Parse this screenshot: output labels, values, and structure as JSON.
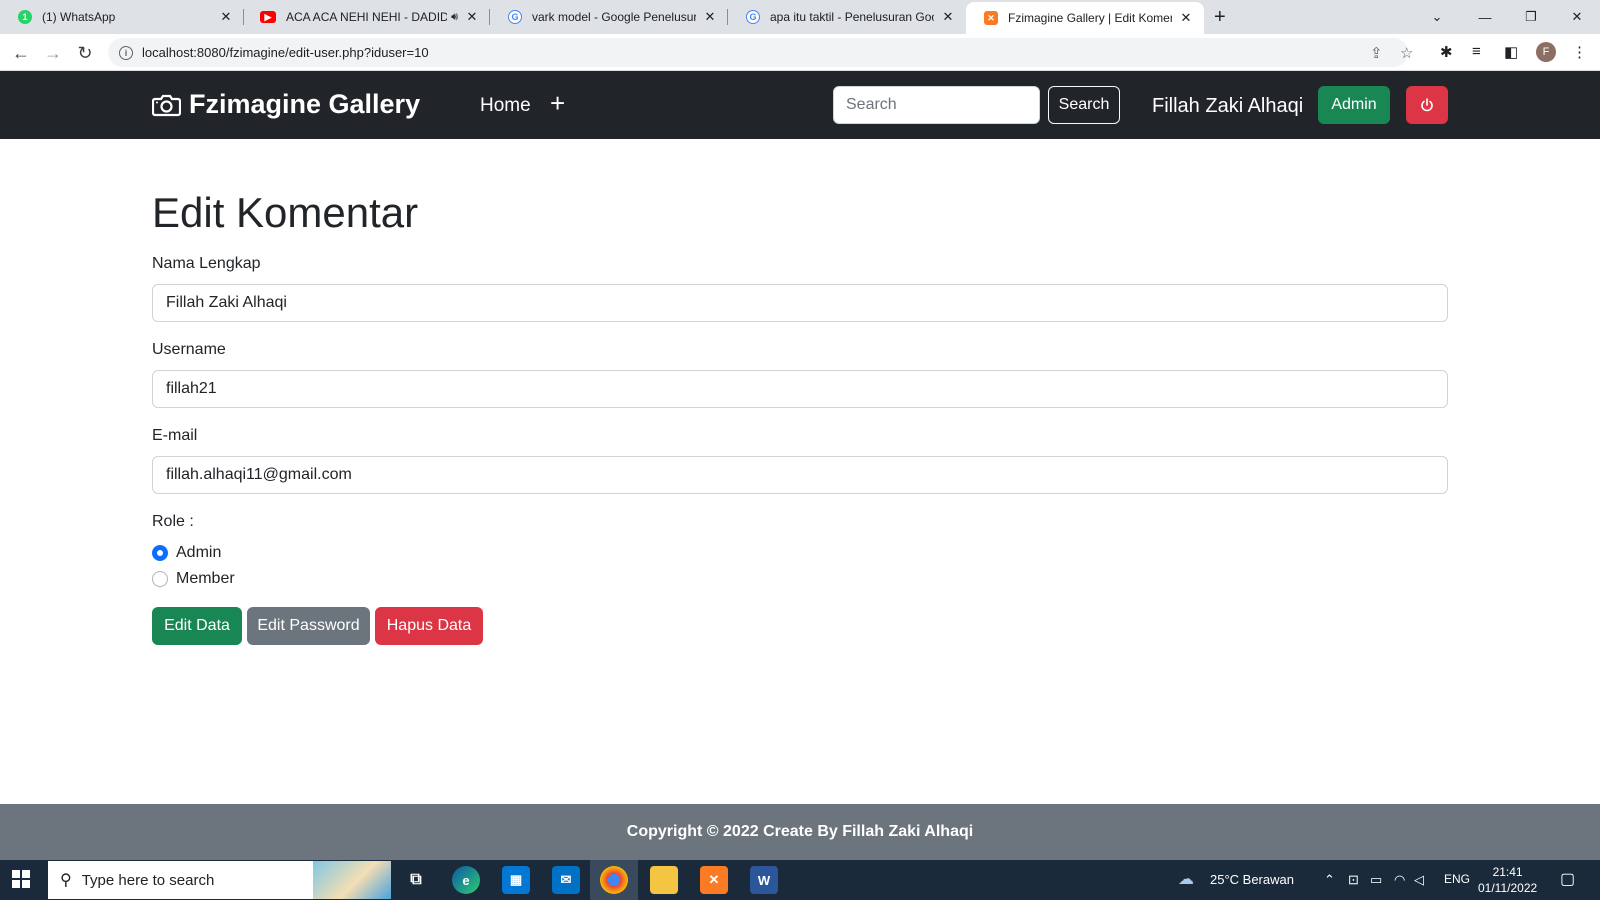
{
  "browser": {
    "tabs": [
      {
        "title": "(1) WhatsApp",
        "icon": "whatsapp-icon",
        "color": "#25d366"
      },
      {
        "title": "ACA ACA NEHI NEHI - DADIDADIDA",
        "icon": "youtube-icon",
        "color": "#ff0000"
      },
      {
        "title": "vark model - Google Penelusuran",
        "icon": "google-icon",
        "color": "#4285f4"
      },
      {
        "title": "apa itu taktil - Penelusuran Google",
        "icon": "google-icon",
        "color": "#4285f4"
      },
      {
        "title": "Fzimagine Gallery | Edit Komentar",
        "icon": "xampp-icon",
        "color": "#fb7a24"
      }
    ],
    "url": "localhost:8080/fzimagine/edit-user.php?iduser=10",
    "profile_initial": "F"
  },
  "navbar": {
    "brand": "Fzimagine Gallery",
    "home": "Home",
    "add": "+",
    "search_placeholder": "Search",
    "search_button": "Search",
    "user_name": "Fillah Zaki Alhaqi",
    "role_button": "Admin",
    "colors": {
      "bg": "#212529",
      "admin": "#198754",
      "logout": "#dc3545"
    }
  },
  "form": {
    "title": "Edit Komentar",
    "fullname_label": "Nama Lengkap",
    "fullname_value": "Fillah Zaki Alhaqi",
    "username_label": "Username",
    "username_value": "fillah21",
    "email_label": "E-mail",
    "email_value": "fillah.alhaqi11@gmail.com",
    "role_label": "Role :",
    "role_options": [
      {
        "label": "Admin",
        "checked": true
      },
      {
        "label": "Member",
        "checked": false
      }
    ],
    "buttons": {
      "edit_data": "Edit Data",
      "edit_password": "Edit Password",
      "delete_data": "Hapus Data"
    },
    "button_colors": {
      "edit_data": "#198754",
      "edit_password": "#6c757d",
      "delete_data": "#dc3545"
    }
  },
  "footer": {
    "text": "Copyright © 2022 Create By Fillah Zaki Alhaqi"
  },
  "taskbar": {
    "search_placeholder": "Type here to search",
    "weather": "25°C  Berawan",
    "language": "ENG",
    "time": "21:41",
    "date": "01/11/2022",
    "apps": [
      "task-view-icon",
      "edge-icon",
      "store-icon",
      "mail-icon",
      "chrome-icon",
      "file-explorer-icon",
      "xampp-icon",
      "word-icon"
    ]
  }
}
